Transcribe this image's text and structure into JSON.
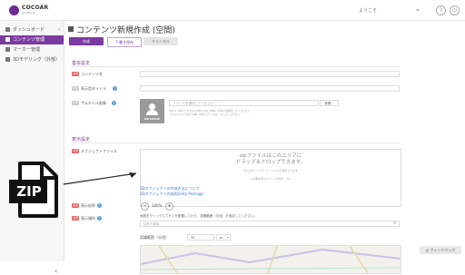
{
  "topbar": {
    "logo_text": "COCOAR",
    "logo_sub": "by SPinno",
    "welcome": "ようこそ",
    "caret": "⌄"
  },
  "sidebar": {
    "items": [
      {
        "label": "ダッシュボード",
        "active": false
      },
      {
        "label": "コンテンツ管理",
        "active": true
      },
      {
        "label": "マーカー管理",
        "active": false
      },
      {
        "label": "3Dモデリング（外部）",
        "active": false
      }
    ],
    "collapse": "‹"
  },
  "page": {
    "title": "コンテンツ新規作成 (空間)",
    "buttons": {
      "create": "作成",
      "draft": "下書き保存",
      "cancel": "キャンセル"
    }
  },
  "basic": {
    "section_title": "基本設定",
    "fields": {
      "content_name": {
        "badge": "必須",
        "label": "コンテンツ名"
      },
      "display_title": {
        "badge": "任意",
        "label": "表示用タイトル"
      },
      "thumbnail": {
        "badge": "任意",
        "label": "サムネイル画像",
        "placeholder": "ファイルを選択してください...",
        "browse": "参照...",
        "note": "320 x 180 ピクセル以内の JPG, PNG, JPEG を指定してください。",
        "note2": "ファイルサイズは 1MB 以内でアップロードしてください。",
        "noimage": "NO IMAGE"
      }
    }
  },
  "display": {
    "section_title": "表示設定",
    "object_file": {
      "badge": "必須",
      "label": "オブジェクトファイル",
      "drop_main_1": "zipファイルはこのエリアに",
      "drop_main_2": "ドラッグ＆ドロップできます。",
      "drop_sub_1": "またはクリックしてファイルを選択できます",
      "drop_sub_2": "※同期対象のファイル形式：.zip",
      "link1": "3Dオブジェクトの作成方法について",
      "link2": "3Dオブジェクト作成用Unity Package"
    },
    "scale": {
      "badge": "必須",
      "label": "表示倍率",
      "value": "100%",
      "minus": "−",
      "plus": "+"
    },
    "location": {
      "badge": "必須",
      "label": "表示場所",
      "hint": "地図をクリックしてピンを配置してから、認識範囲（半径）を指定してください。",
      "search_placeholder": "住所で検索",
      "radius_label": "認識範囲（半径）",
      "radius_value": "30",
      "radius_unit": "m"
    }
  },
  "feedback": "◎ フィードバック",
  "overlay": {
    "zip_label": "ZIP"
  },
  "colors": {
    "accent": "#7b3aa0",
    "required": "#e06262",
    "link": "#3b74c4"
  }
}
